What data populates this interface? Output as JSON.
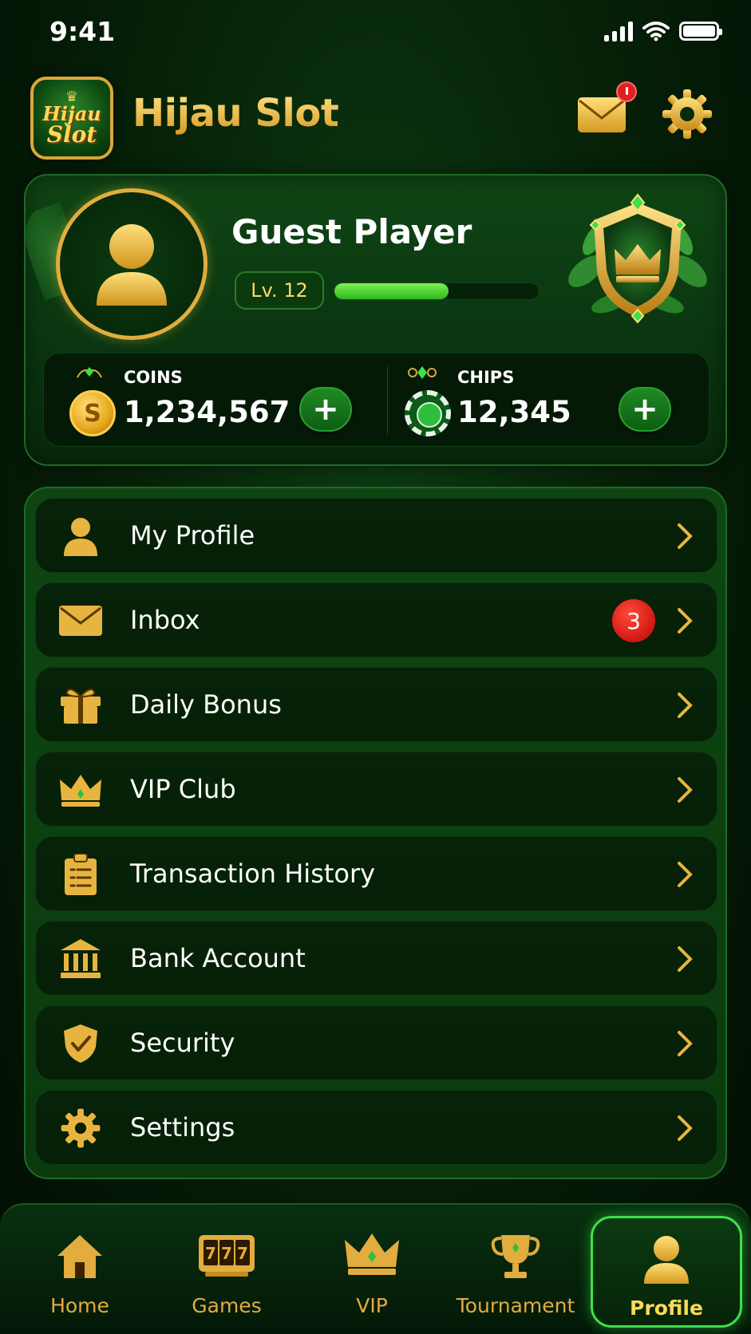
{
  "status_bar": {
    "time": "9:41"
  },
  "header": {
    "logo": {
      "line1": "Hijau",
      "line2": "Slot"
    },
    "title": "Hijau Slot"
  },
  "profile": {
    "name": "Guest Player",
    "level": "Lv. 12",
    "xp_progress": 0.56
  },
  "wallet": {
    "coins": {
      "label": "COINS",
      "value": "1,234,567",
      "coin_symbol": "S"
    },
    "chips": {
      "label": "CHIPS",
      "value": "12,345"
    },
    "plus_symbol": "+"
  },
  "menu": {
    "items": [
      {
        "label": "My Profile",
        "icon": "user-icon"
      },
      {
        "label": "Inbox",
        "icon": "mail-icon",
        "badge": "3"
      },
      {
        "label": "Daily Bonus",
        "icon": "gift-icon"
      },
      {
        "label": "VIP Club",
        "icon": "crown-icon"
      },
      {
        "label": "Transaction History",
        "icon": "clipboard-icon"
      },
      {
        "label": "Bank Account",
        "icon": "bank-icon"
      },
      {
        "label": "Security",
        "icon": "shield-icon"
      },
      {
        "label": "Settings",
        "icon": "gear-icon"
      }
    ]
  },
  "bottom_nav": {
    "items": [
      {
        "label": "Home",
        "icon": "home-icon"
      },
      {
        "label": "Games",
        "icon": "slot-machine-icon",
        "icon_text": "777"
      },
      {
        "label": "VIP",
        "icon": "crown-icon"
      },
      {
        "label": "Tournament",
        "icon": "trophy-icon"
      },
      {
        "label": "Profile",
        "icon": "user-icon",
        "active": true
      }
    ]
  },
  "colors": {
    "gold": "#e2ac3e",
    "accent_green": "#3ee04a",
    "badge_red": "#d01812",
    "background": "#062208"
  }
}
